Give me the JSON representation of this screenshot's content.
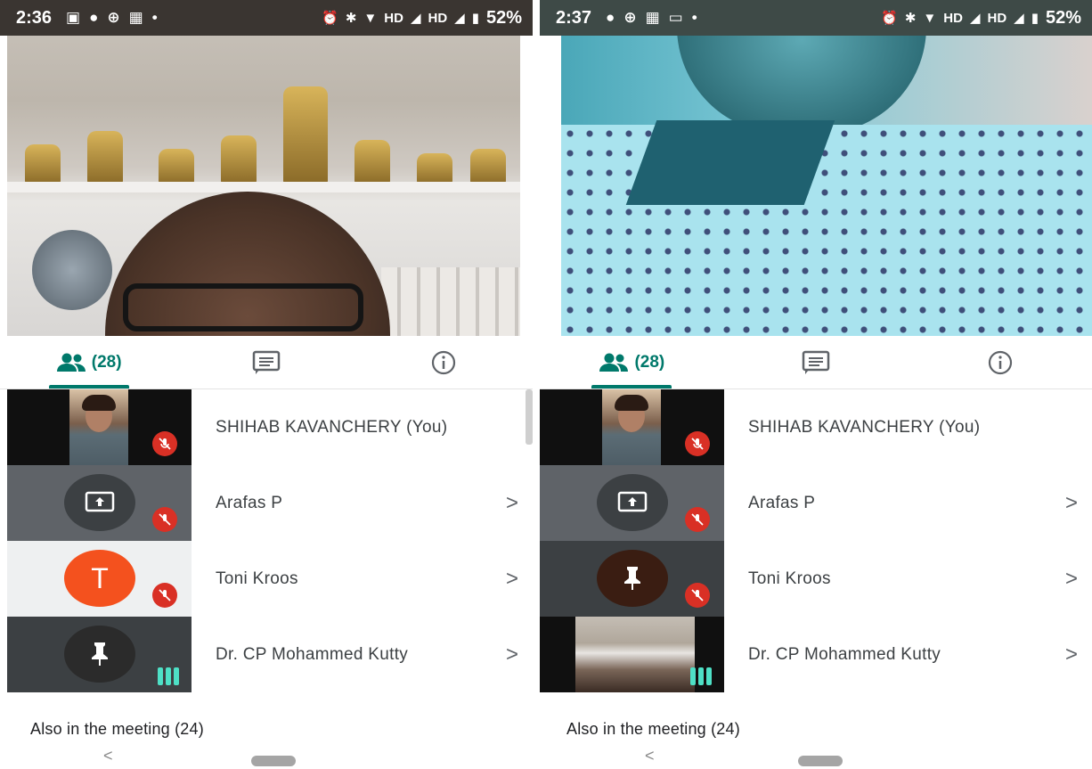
{
  "panels": [
    {
      "status": {
        "time": "2:36",
        "battery": "52%"
      },
      "tabs": {
        "people_count": "(28)"
      },
      "participants": [
        {
          "name": "SHIHAB KAVANCHERY (You)"
        },
        {
          "name": "Arafas P"
        },
        {
          "name": "Toni Kroos",
          "avatar_letter": "T"
        },
        {
          "name": "Dr. CP Mohammed Kutty"
        }
      ],
      "also": "Also in the meeting (24)"
    },
    {
      "status": {
        "time": "2:37",
        "battery": "52%"
      },
      "tabs": {
        "people_count": "(28)"
      },
      "participants": [
        {
          "name": "SHIHAB KAVANCHERY (You)"
        },
        {
          "name": "Arafas P"
        },
        {
          "name": "Toni Kroos"
        },
        {
          "name": "Dr. CP Mohammed Kutty"
        }
      ],
      "also": "Also in the meeting (24)"
    }
  ],
  "status_network": "HD",
  "chevron": ">",
  "nav_back": "<",
  "colors": {
    "accent": "#00796b",
    "mute": "#d93025",
    "avatar": "#f4511e",
    "audio_bars": "#4ee0c6"
  },
  "icons": [
    "people-icon",
    "chat-icon",
    "info-icon",
    "mic-off-icon",
    "present-screen-icon",
    "pin-icon",
    "audio-level-icon",
    "alarm-icon",
    "bluetooth-icon",
    "wifi-icon",
    "signal-icon",
    "battery-icon"
  ]
}
